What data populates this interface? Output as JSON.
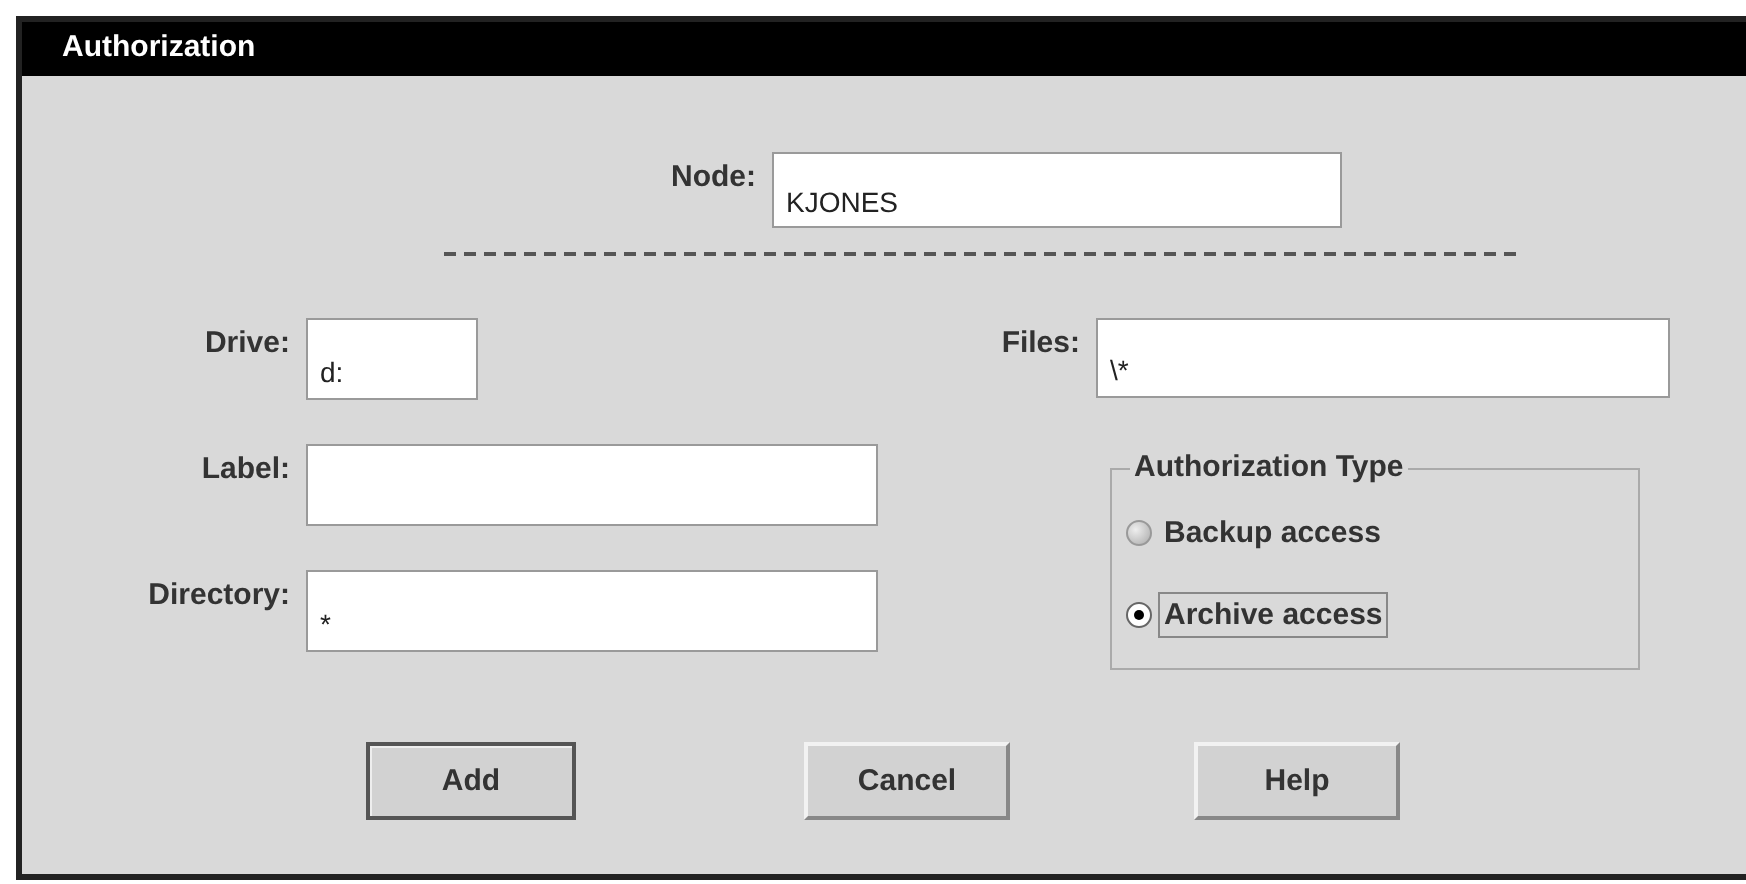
{
  "window": {
    "title": "Authorization"
  },
  "node": {
    "label": "Node:",
    "value": "KJONES"
  },
  "fields": [
    {
      "label": "Drive:",
      "value": "d:"
    },
    {
      "label": "Label:"
    },
    {
      "label": "Directory:",
      "value": "*"
    }
  ],
  "files": {
    "label": "Files:",
    "value": "\\*"
  },
  "authorization_type": {
    "title": "Authorization Type",
    "options": [
      {
        "label": "Backup access",
        "selected": false,
        "focused": false
      },
      {
        "label": "Archive access",
        "selected": true,
        "focused": true
      }
    ]
  },
  "buttons": [
    {
      "label": "Add",
      "default": true
    },
    {
      "label": "Cancel",
      "default": false
    },
    {
      "label": "Help",
      "default": false
    }
  ]
}
